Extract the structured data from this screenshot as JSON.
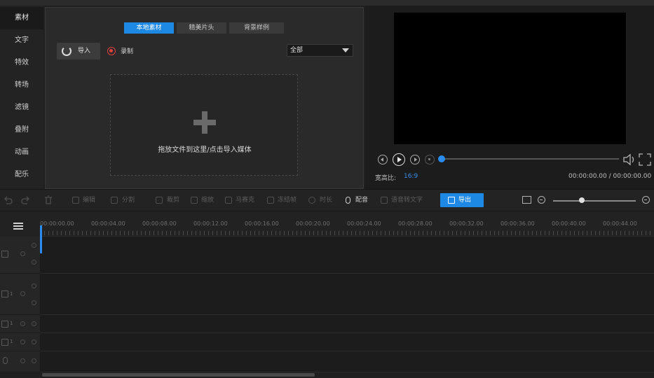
{
  "sidebar": {
    "items": [
      {
        "label": "素材",
        "active": true
      },
      {
        "label": "文字"
      },
      {
        "label": "特效"
      },
      {
        "label": "转场"
      },
      {
        "label": "滤镜"
      },
      {
        "label": "叠附"
      },
      {
        "label": "动画"
      },
      {
        "label": "配乐"
      }
    ]
  },
  "media": {
    "tabs": [
      {
        "label": "本地素材",
        "active": true
      },
      {
        "label": "精美片头"
      },
      {
        "label": "背景样例"
      }
    ],
    "import_label": "导入",
    "record_label": "录制",
    "filter_value": "全部",
    "drop_text": "拖放文件到这里/点击导入媒体"
  },
  "preview": {
    "aspect_label": "宽高比:",
    "aspect_value": "16:9",
    "time": "00:00:00.00 / 00:00:00.00",
    "progress": 0
  },
  "toolbar": {
    "items": [
      "编辑",
      "分割",
      "裁剪",
      "缩放",
      "马赛克",
      "冻结帧",
      "时长",
      "配音",
      "语音转文字"
    ],
    "export_label": "导出",
    "zoom_level": 0.35
  },
  "timeline": {
    "ruler_labels": [
      "00:00:00.00",
      "00:00:04.00",
      "00:00:08.00",
      "00:00:12.00",
      "00:00:16.00",
      "00:00:20.00",
      "00:00:24.00",
      "00:00:28.00",
      "00:00:32.00",
      "00:00:36.00",
      "00:00:40.00",
      "00:00:44.00"
    ],
    "track_numbers": [
      "1",
      "1",
      "1"
    ]
  },
  "colors": {
    "accent": "#1e88e5",
    "record": "#e04040"
  }
}
